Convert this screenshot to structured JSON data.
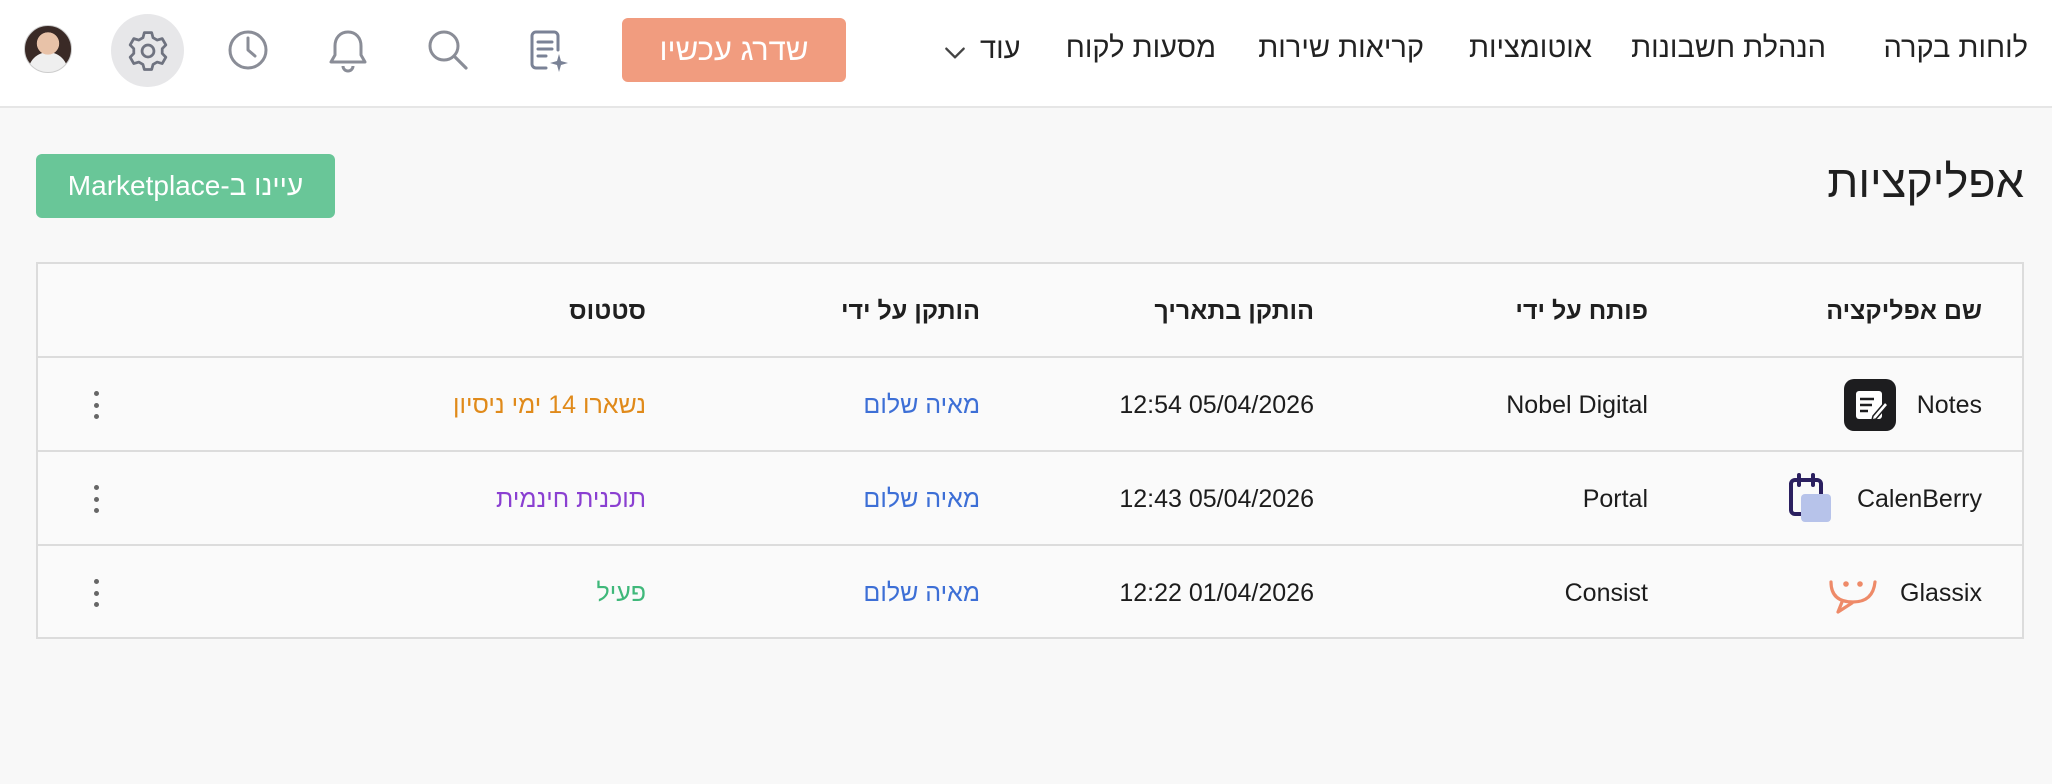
{
  "nav": {
    "items": [
      "לוחות בקרה",
      "הנהלת חשבונות",
      "אוטומציות",
      "קריאות שירות",
      "מסעות לקוח"
    ],
    "more_label": "עוד",
    "upgrade_label": "שדרג עכשיו"
  },
  "header": {
    "title": "אפליקציות",
    "marketplace_label": "עיינו ב-Marketplace"
  },
  "table": {
    "columns": {
      "name": "שם אפליקציה",
      "developer": "פותח על ידי",
      "installed_date": "הותקן בתאריך",
      "installed_by": "הותקן על ידי",
      "status": "סטטוס"
    },
    "rows": [
      {
        "name": "Notes",
        "developer": "Nobel Digital",
        "installed_date": "12:54 05/04/2026",
        "installed_by": "מאיה שלום",
        "status": "נשארו 14 ימי ניסיון",
        "status_color": "#e08a1a",
        "icon": "notes-icon"
      },
      {
        "name": "CalenBerry",
        "developer": "Portal",
        "installed_date": "12:43 05/04/2026",
        "installed_by": "מאיה שלום",
        "status": "תוכנית חינמית",
        "status_color": "#8a3fd1",
        "icon": "calenberry-icon"
      },
      {
        "name": "Glassix",
        "developer": "Consist",
        "installed_date": "12:22 01/04/2026",
        "installed_by": "מאיה שלום",
        "status": "פעיל",
        "status_color": "#3fb87a",
        "icon": "glassix-icon"
      }
    ]
  },
  "colors": {
    "upgrade_button": "#f19c7f",
    "marketplace_button": "#69c698",
    "link": "#3d6fd6"
  }
}
